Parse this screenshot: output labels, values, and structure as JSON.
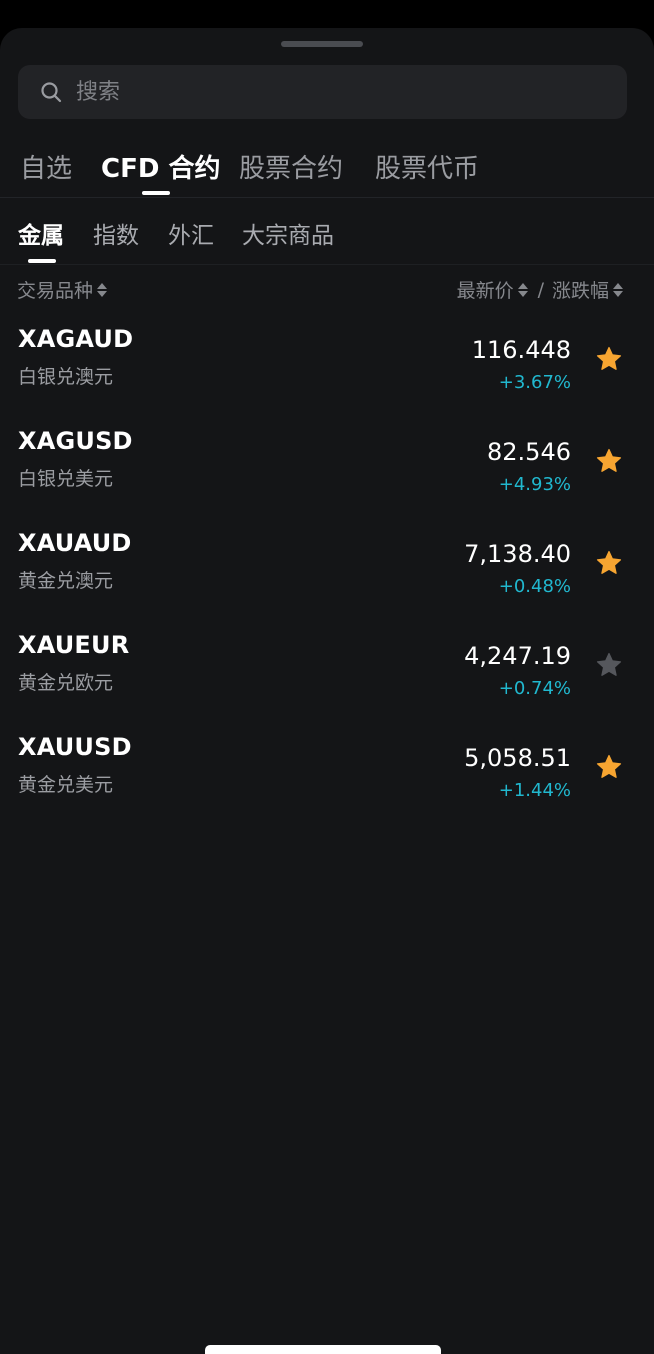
{
  "search": {
    "placeholder": "搜索"
  },
  "main_tabs": [
    {
      "label": "自选",
      "active": false
    },
    {
      "label": "CFD 合约",
      "active": true
    },
    {
      "label": "股票合约",
      "active": false
    },
    {
      "label": "股票代币",
      "active": false
    }
  ],
  "sub_tabs": [
    {
      "label": "金属",
      "active": true
    },
    {
      "label": "指数",
      "active": false
    },
    {
      "label": "外汇",
      "active": false
    },
    {
      "label": "大宗商品",
      "active": false
    }
  ],
  "columns": {
    "symbol": "交易品种",
    "price": "最新价",
    "separator": "/",
    "change": "涨跌幅"
  },
  "instruments": [
    {
      "symbol": "XAGAUD",
      "name": "白银兑澳元",
      "price": "116.448",
      "change": "+3.67%",
      "favorite": true
    },
    {
      "symbol": "XAGUSD",
      "name": "白银兑美元",
      "price": "82.546",
      "change": "+4.93%",
      "favorite": true
    },
    {
      "symbol": "XAUAUD",
      "name": "黄金兑澳元",
      "price": "7,138.40",
      "change": "+0.48%",
      "favorite": true
    },
    {
      "symbol": "XAUEUR",
      "name": "黄金兑欧元",
      "price": "4,247.19",
      "change": "+0.74%",
      "favorite": false
    },
    {
      "symbol": "XAUUSD",
      "name": "黄金兑美元",
      "price": "5,058.51",
      "change": "+1.44%",
      "favorite": true
    }
  ],
  "colors": {
    "background": "#141517",
    "positive_change": "#21b8cf",
    "favorite_star": "#f7a531",
    "unfavorite_star": "#55575c"
  },
  "icons": {
    "search": "search-icon",
    "sort": "sort-icon",
    "favorite": "star-icon"
  }
}
